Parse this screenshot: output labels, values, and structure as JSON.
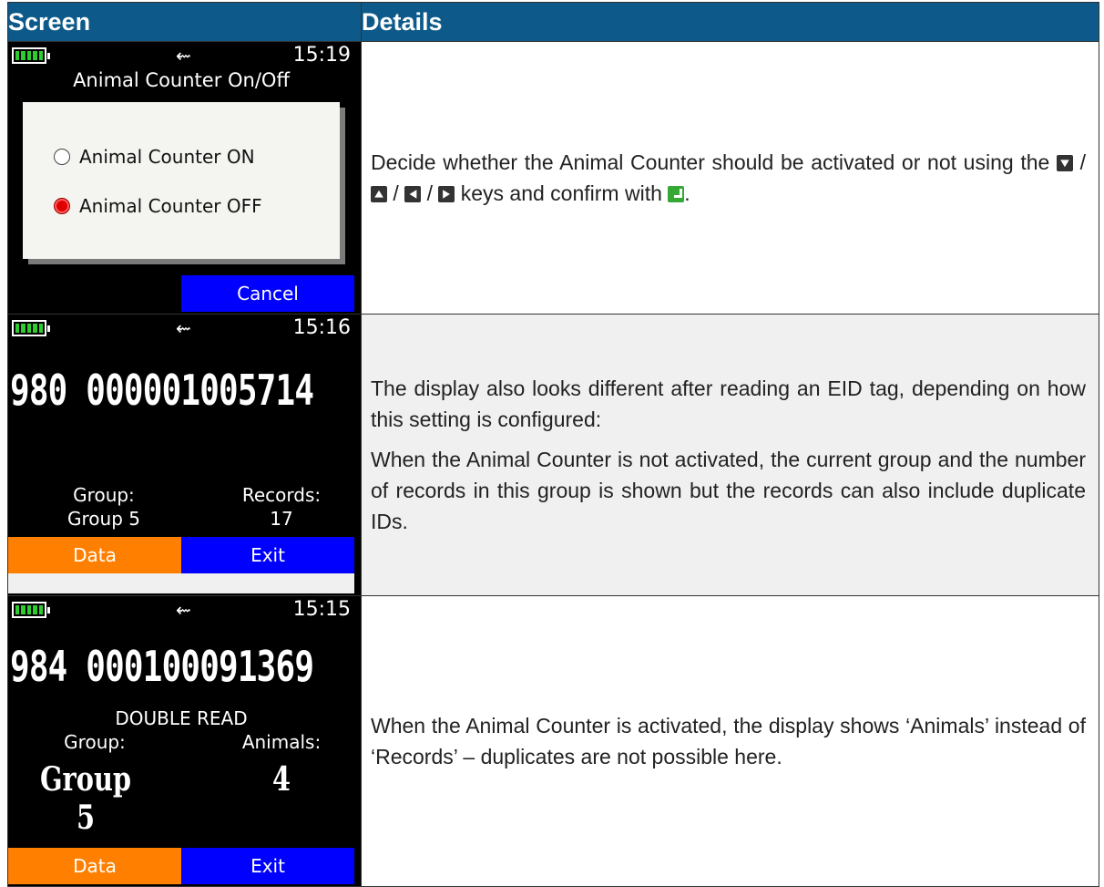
{
  "header": {
    "col1": "Screen",
    "col2": "Details"
  },
  "rows": [
    {
      "screen": {
        "clock": "15:19",
        "title": "Animal Counter On/Off",
        "option_on": "Animal Counter ON",
        "option_off": "Animal Counter OFF",
        "selected": "off",
        "cancel": "Cancel"
      },
      "details": {
        "p1_a": "Decide whether the Animal Counter should be activated or not using the",
        "sep": "/",
        "p1_b": "keys and confirm with",
        "p1_end": "."
      }
    },
    {
      "screen": {
        "clock": "15:16",
        "eid": "980 000001005714",
        "group_label": "Group:",
        "group_value": "Group 5",
        "records_label": "Records:",
        "records_value": "17",
        "btn_left": "Data",
        "btn_right": "Exit"
      },
      "details": {
        "p1": "The display also looks different after reading an EID tag, depending on how this setting is configured:",
        "p2": "When the Animal Counter is not activated, the current group and the number of records in this group is shown but the records can also include duplicate IDs."
      }
    },
    {
      "screen": {
        "clock": "15:15",
        "eid": "984 000100091369",
        "status": "DOUBLE READ",
        "group_label": "Group:",
        "group_value": "Group 5",
        "animals_label": "Animals:",
        "animals_value": "4",
        "btn_left": "Data",
        "btn_right": "Exit"
      },
      "details": {
        "p1": "When the Animal Counter is activated, the display shows ‘Animals’ instead of ‘Records’ – duplicates are not possible here."
      }
    }
  ],
  "icons": [
    "battery-icon",
    "usb-icon",
    "down-key-icon",
    "up-key-icon",
    "left-key-icon",
    "right-key-icon",
    "enter-key-icon"
  ],
  "colors": {
    "header_bg": "#0d5a8a",
    "orange_button": "#ff8000",
    "blue_button": "#0000ff",
    "radio_selected": "#e00000",
    "battery": "#2ecc2e"
  }
}
